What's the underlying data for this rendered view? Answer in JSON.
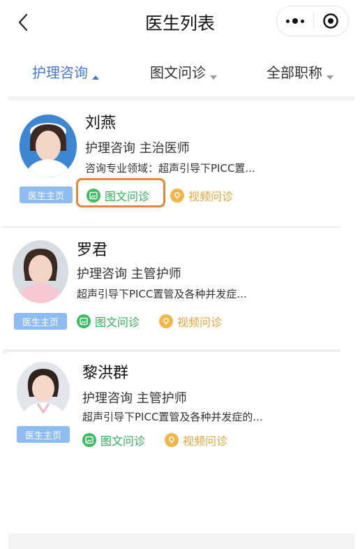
{
  "nav": {
    "title": "医生列表",
    "back_icon": "chevron-left-icon",
    "more_icon": "more-dots-icon",
    "capsule_close_icon": "target-circle-icon"
  },
  "filters": [
    {
      "label": "护理咨询",
      "active": true,
      "caret": "up"
    },
    {
      "label": "图文问诊",
      "active": false,
      "caret": "down"
    },
    {
      "label": "全部职称",
      "active": false,
      "caret": "down"
    }
  ],
  "doctors": [
    {
      "name": "刘燕",
      "title": "护理咨询  主治医师",
      "field": "咨询专业领域：超声引导下PICC置...",
      "homepage_label": "医生主页",
      "text_consult_label": "图文问诊",
      "video_consult_label": "视频问诊",
      "text_consult_highlighted": true
    },
    {
      "name": "罗君",
      "title": "护理咨询  主管护师",
      "field": "超声引导下PICC置管及各种并发症...",
      "homepage_label": "医生主页",
      "text_consult_label": "图文问诊",
      "video_consult_label": "视频问诊"
    },
    {
      "name": "黎洪群",
      "title": "护理咨询  主管护师",
      "field": "超声引导下PICC置管及各种并发症的...",
      "homepage_label": "医生主页",
      "text_consult_label": "图文问诊",
      "video_consult_label": "视频问诊"
    }
  ],
  "colors": {
    "accent_blue": "#4a78c8",
    "homepage_badge": "#8ebcf0",
    "text_consult_green": "#2fae58",
    "video_consult_orange": "#e5a23a",
    "highlight_orange": "#e9823a"
  }
}
